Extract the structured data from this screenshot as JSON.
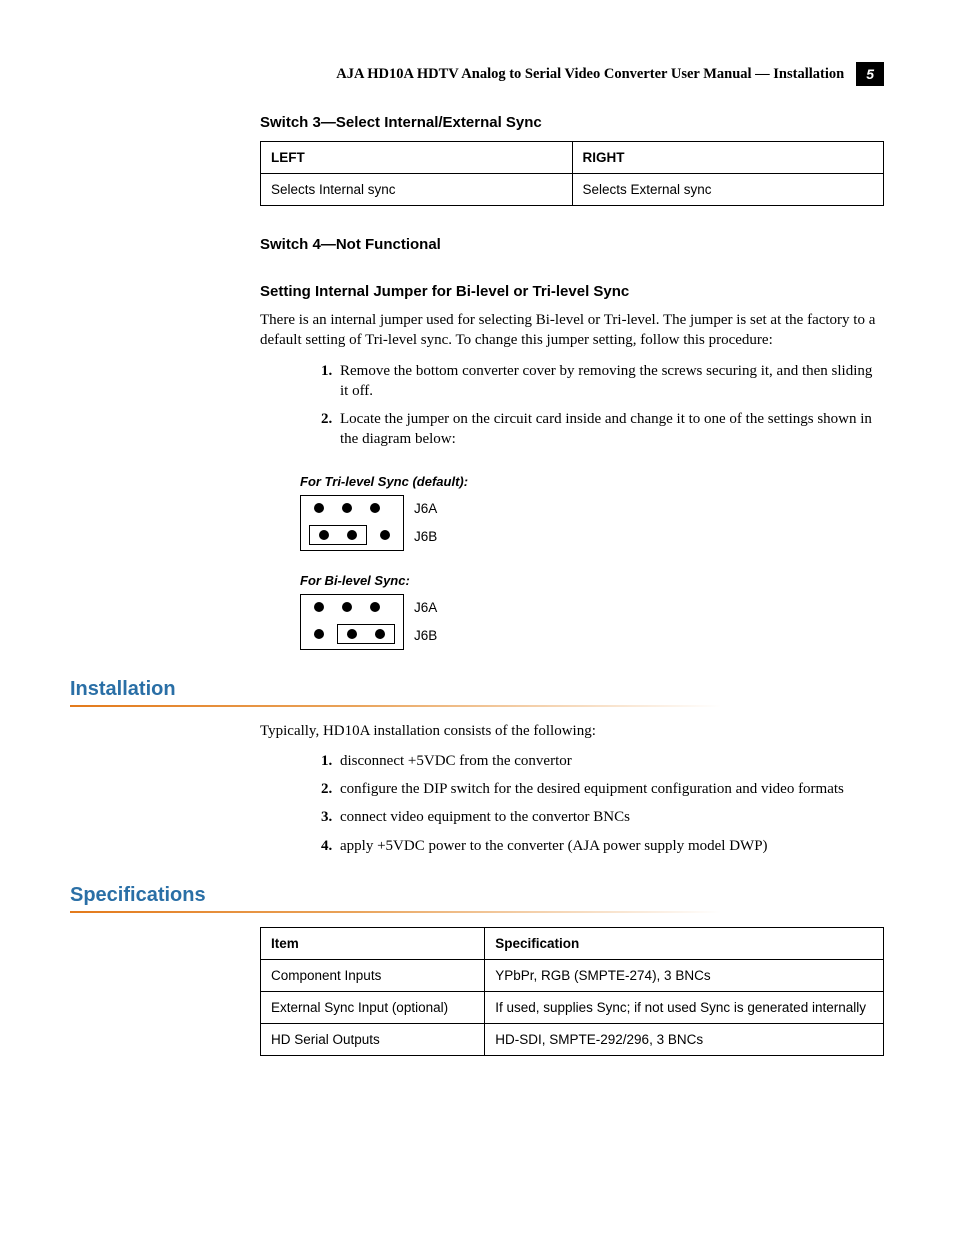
{
  "header": {
    "title": "AJA HD10A HDTV Analog to Serial Video Converter User Manual — Installation",
    "page_number": "5"
  },
  "switch3": {
    "heading": "Switch 3—Select Internal/External Sync",
    "left_header": "LEFT",
    "right_header": "RIGHT",
    "left_val": "Selects Internal sync",
    "right_val": "Selects External sync"
  },
  "switch4": {
    "heading": "Switch 4—Not Functional"
  },
  "jumper_section": {
    "heading": "Setting Internal Jumper for Bi-level or Tri-level Sync",
    "body": "There is an internal jumper used for selecting Bi-level or Tri-level. The jumper is set at the factory to a default setting of Tri-level sync. To change this jumper setting, follow this procedure:",
    "steps": [
      "Remove the bottom converter cover by removing the screws securing it, and then sliding it off.",
      "Locate the jumper on the circuit card inside and change it to one of the settings shown in the diagram below:"
    ],
    "diag_tri_caption": "For Tri-level Sync (default):",
    "diag_bi_caption": "For Bi-level Sync:",
    "row_label_a": "J6A",
    "row_label_b": "J6B"
  },
  "installation": {
    "heading": "Installation",
    "body": "Typically, HD10A installation consists of the following:",
    "steps": [
      "disconnect +5VDC from the convertor",
      "configure the DIP switch for the desired equipment configuration and video formats",
      "connect video equipment to the convertor BNCs",
      "apply +5VDC power to the converter (AJA power supply model DWP)"
    ]
  },
  "specifications": {
    "heading": "Specifications",
    "col_item": "Item",
    "col_spec": "Specification",
    "rows": [
      {
        "item": "Component Inputs",
        "spec": "YPbPr, RGB (SMPTE-274), 3 BNCs"
      },
      {
        "item": "External Sync Input (optional)",
        "spec": "If used, supplies Sync; if not used Sync is generated internally"
      },
      {
        "item": "HD Serial Outputs",
        "spec": "HD-SDI, SMPTE-292/296, 3 BNCs"
      }
    ]
  }
}
